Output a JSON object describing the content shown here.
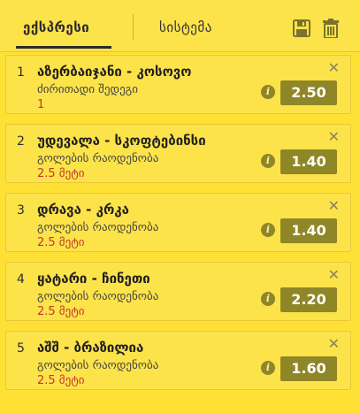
{
  "tabs": {
    "express": "ექსპრესი",
    "system": "სისტემა"
  },
  "icons": {
    "save": "save-icon",
    "trash": "trash-icon",
    "close": "close-icon",
    "info": "info-icon"
  },
  "colors": {
    "background": "#ffe135",
    "accent": "#8f8627",
    "selection": "#c0392b"
  },
  "bets": [
    {
      "num": "1",
      "match": "აზერბაიჯანი - კოსოვო",
      "market": "ძირითადი შედეგი",
      "selection": "1",
      "odd": "2.50",
      "close": "✕",
      "info": "i"
    },
    {
      "num": "2",
      "match": "უდევალა - სკოფტებინსი",
      "market": "გოლების რაოდენობა",
      "selection": "2.5 მეტი",
      "odd": "1.40",
      "close": "✕",
      "info": "i"
    },
    {
      "num": "3",
      "match": "დრავა - კრკა",
      "market": "გოლების რაოდენობა",
      "selection": "2.5 მეტი",
      "odd": "1.40",
      "close": "✕",
      "info": "i"
    },
    {
      "num": "4",
      "match": "ყატარი - ჩინეთი",
      "market": "გოლების რაოდენობა",
      "selection": "2.5 მეტი",
      "odd": "2.20",
      "close": "✕",
      "info": "i"
    },
    {
      "num": "5",
      "match": "აშშ - ბრაზილია",
      "market": "გოლების რაოდენობა",
      "selection": "2.5 მეტი",
      "odd": "1.60",
      "close": "✕",
      "info": "i"
    }
  ]
}
